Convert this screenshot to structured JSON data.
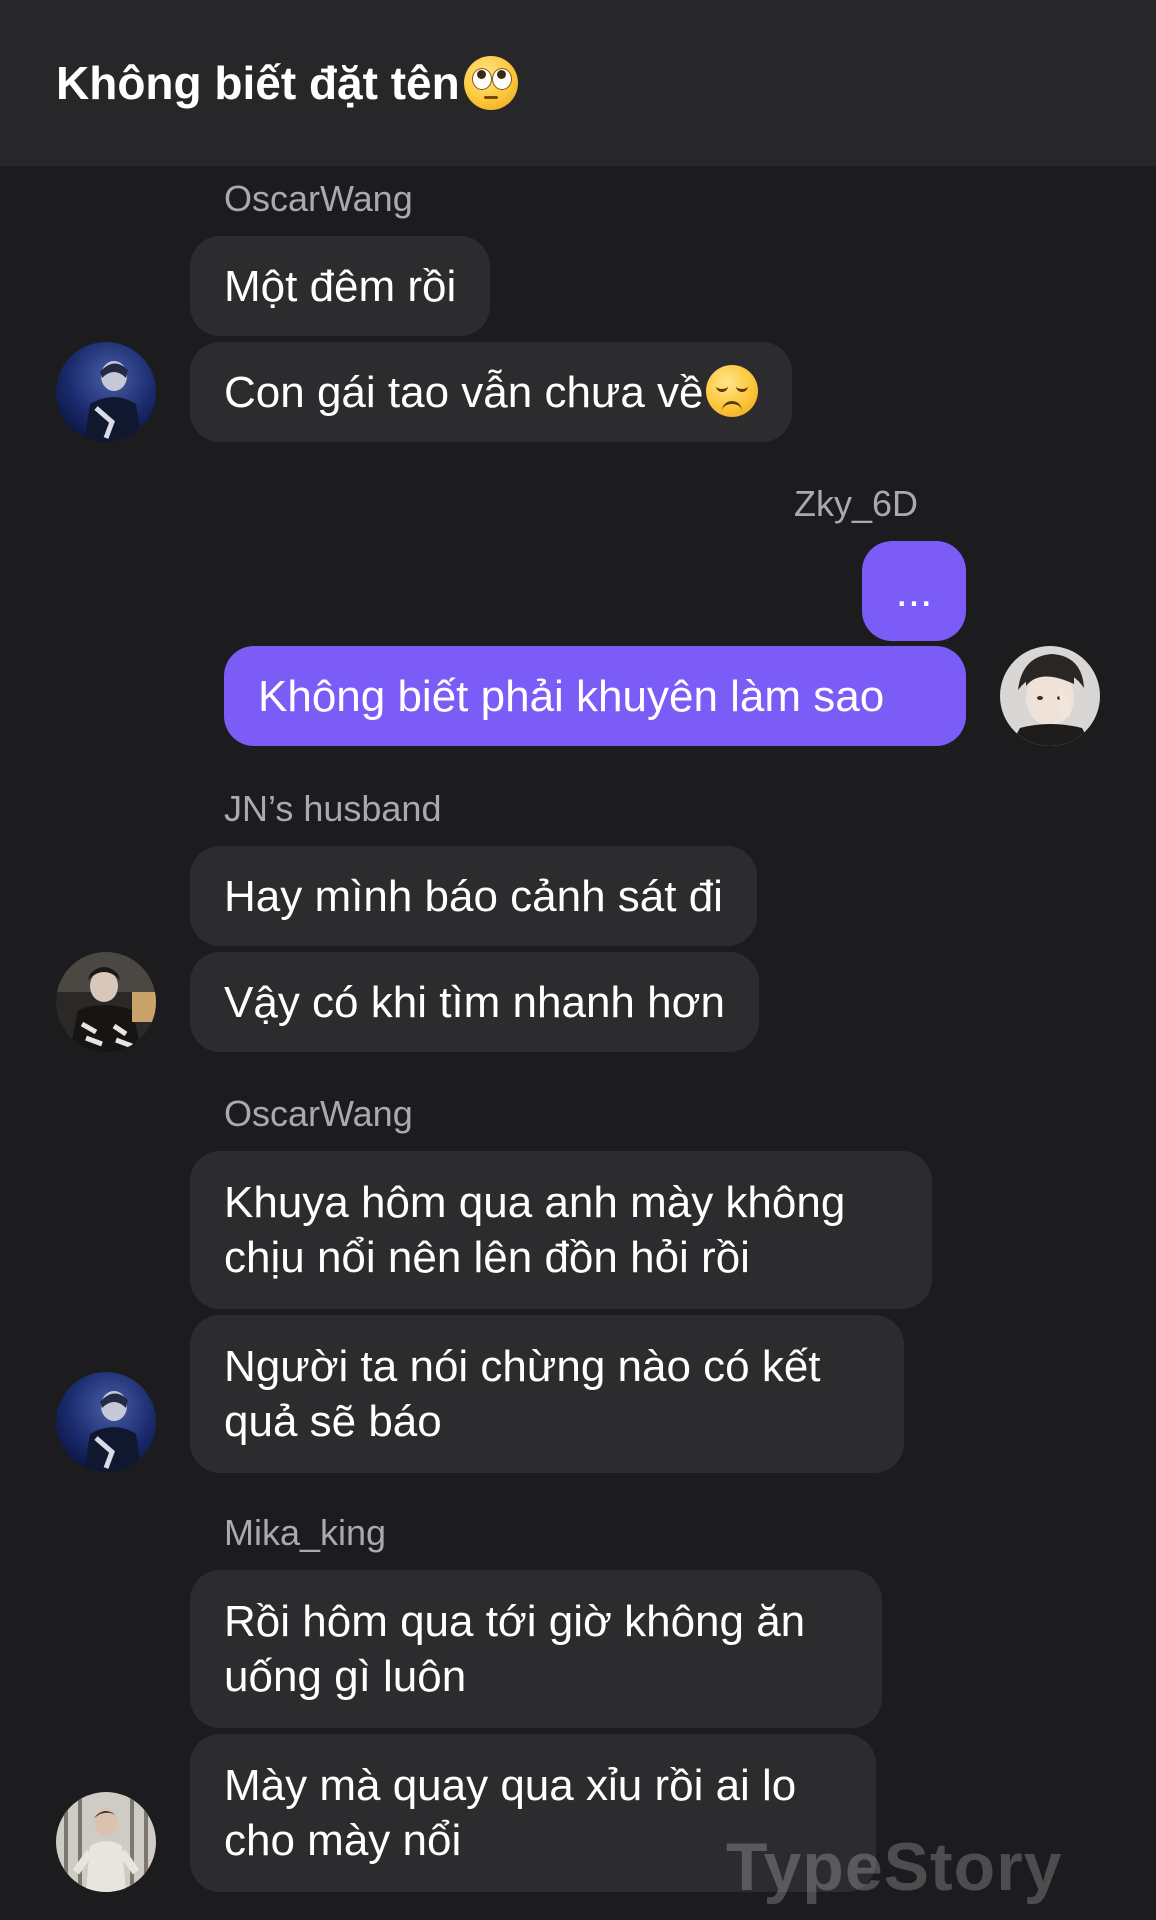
{
  "header": {
    "title": "Không biết đặt tên",
    "title_emoji_icon": "eye-roll-emoji-icon"
  },
  "messages": [
    {
      "sender": "OscarWang",
      "side": "left",
      "avatar": "oscarwang-avatar",
      "bubbles": [
        "Một đêm rồi",
        "Con gái tao vẫn chưa về"
      ]
    },
    {
      "sender": "Zky_6D",
      "side": "right",
      "avatar": "zky-avatar",
      "bubbles": [
        "...",
        "Không biết phải khuyên làm sao"
      ]
    },
    {
      "sender": "JN’s husband",
      "side": "left",
      "avatar": "jn-husband-avatar",
      "bubbles": [
        "Hay mình báo cảnh sát đi",
        "Vậy có khi tìm nhanh hơn"
      ]
    },
    {
      "sender": "OscarWang",
      "side": "left",
      "avatar": "oscarwang-avatar",
      "bubbles": [
        "Khuya hôm qua anh mày không chịu nổi nên lên đồn hỏi rồi",
        "Người ta nói chừng nào có kết quả sẽ báo"
      ]
    },
    {
      "sender": "Mika_king",
      "side": "left",
      "avatar": "mika-king-avatar",
      "bubbles": [
        "Rồi hôm qua tới giờ không ăn uống gì luôn",
        "Mày mà quay qua xỉu rồi ai lo cho mày nổi"
      ]
    }
  ],
  "watermark": "TypeStory",
  "colors": {
    "background": "#1c1c1e",
    "header": "#27272a",
    "bubble_other": "#2c2c2f",
    "bubble_mine": "#7c5cf7",
    "sender_name": "#a9a9ae"
  }
}
